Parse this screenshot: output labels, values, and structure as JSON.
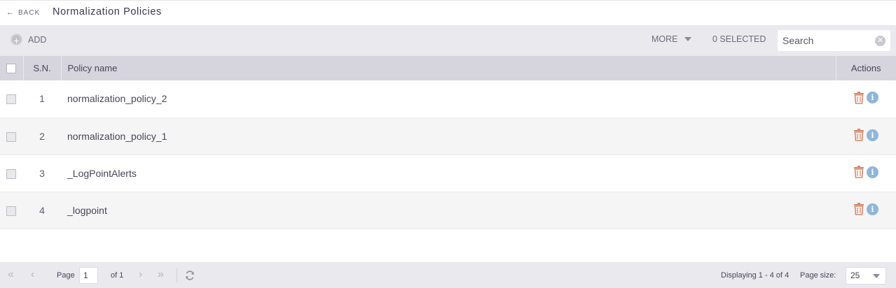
{
  "header": {
    "back_label": "BACK",
    "title": "Normalization Policies"
  },
  "toolbar": {
    "add_label": "ADD",
    "more_label": "MORE",
    "selected_label": "0 SELECTED",
    "search_placeholder": "Search",
    "search_value": ""
  },
  "table": {
    "columns": {
      "sn": "S.N.",
      "name": "Policy name",
      "actions": "Actions"
    },
    "rows": [
      {
        "sn": "1",
        "name": "normalization_policy_2"
      },
      {
        "sn": "2",
        "name": "normalization_policy_1"
      },
      {
        "sn": "3",
        "name": "_LogPointAlerts"
      },
      {
        "sn": "4",
        "name": "_logpoint"
      }
    ]
  },
  "pagination": {
    "page_label": "Page",
    "current_page": "1",
    "of_label": "of 1",
    "display_info": "Displaying 1 - 4 of 4",
    "page_size_label": "Page size:",
    "page_size": "25"
  },
  "colors": {
    "trash": "#d98a6e",
    "info": "#8fb6d8",
    "header_bg": "#d6d5de",
    "toolbar_bg": "#e9e9ee"
  },
  "icons": {
    "back": "arrow-left-icon",
    "add": "plus-circle-icon",
    "clear": "clear-search-icon",
    "delete": "trash-icon",
    "info": "info-icon",
    "first": "first-page-icon",
    "prev": "prev-page-icon",
    "next": "next-page-icon",
    "last": "last-page-icon",
    "refresh": "refresh-icon"
  }
}
